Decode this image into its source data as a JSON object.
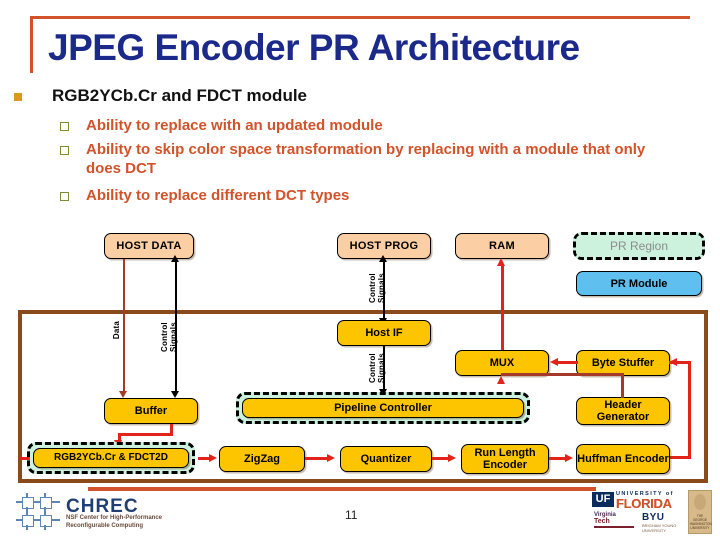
{
  "slide": {
    "title": "JPEG Encoder PR Architecture",
    "page_number": "11",
    "accent_color": "#d2532a",
    "title_color": "#1b2a8a"
  },
  "bullets": {
    "level1": "RGB2YCb.Cr and FDCT module",
    "level2": [
      "Ability to replace with an updated module",
      "Ability to skip color space transformation by replacing with a module that only does DCT",
      "Ability to replace different DCT types"
    ]
  },
  "legend": {
    "pr_region": "PR Region",
    "pr_module": "PR Module",
    "pr_region_fill": "#ccf2dd",
    "pr_module_fill": "#5fc0f0"
  },
  "diagram": {
    "host_nodes": [
      {
        "label": "HOST DATA"
      },
      {
        "label": "HOST PROG"
      },
      {
        "label": "RAM"
      }
    ],
    "modules": [
      {
        "label": "Host IF"
      },
      {
        "label": "MUX"
      },
      {
        "label": "Byte Stuffer"
      },
      {
        "label": "Buffer"
      },
      {
        "label": "Pipeline Controller"
      },
      {
        "label": "Header Generator"
      },
      {
        "label": "RGB2YCb.Cr &  FDCT2D"
      },
      {
        "label": "ZigZag"
      },
      {
        "label": "Quantizer"
      },
      {
        "label": "Run Length Encoder"
      },
      {
        "label": "Huffman Encoder"
      }
    ],
    "wire_labels": {
      "data": "Data",
      "control_signals": "Control Signals"
    },
    "colors": {
      "data_wire": "#a63a28",
      "signal_wire": "#e2231a",
      "control_wire": "#000000",
      "frame": "#8a4a1a",
      "module_fill": "#fdc500",
      "host_fill": "#fbcfa3"
    }
  },
  "footer": {
    "chrec_name": "CHREC",
    "chrec_tagline": "NSF Center for High-Performance Reconfigurable Computing",
    "uf_abbr": "UF",
    "uf_university": "UNIVERSITY of",
    "uf_state": "FLORIDA",
    "vt_name": "Virginia",
    "vt_tech": "Tech",
    "byu_name": "BYU",
    "byu_sub": "BRIGHAM YOUNG UNIVERSITY",
    "gw_sub": "THE GEORGE WASHINGTON UNIVERSITY"
  }
}
